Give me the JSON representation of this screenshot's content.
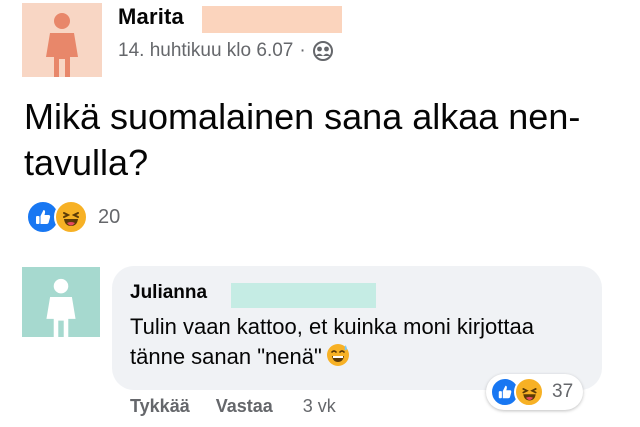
{
  "post": {
    "author": "Marita",
    "timestamp": "14. huhtikuu klo 6.07",
    "separator": "·",
    "audience_icon": "friends-icon",
    "text": "Mikä suomalainen sana alkaa nen- tavulla?",
    "reaction_types": [
      "like",
      "haha"
    ],
    "reaction_count": "20",
    "avatar_color": "#f8d6c4",
    "avatar_figure_color": "#e8876a"
  },
  "comment": {
    "author": "Julianna",
    "text": "Tulin vaan kattoo, et kuinka moni kirjottaa tänne sanan \"nenä\"",
    "emoji": "grinning-sweat-emoji",
    "reaction_types": [
      "like",
      "haha"
    ],
    "reaction_count": "37",
    "actions": {
      "like": "Tykkää",
      "reply": "Vastaa"
    },
    "time_ago": "3 vk",
    "avatar_color": "#a6d9cf",
    "avatar_figure_color": "#ffffff"
  },
  "colors": {
    "like_blue": "#1877f2",
    "haha_yellow": "#f7b125",
    "secondary_text": "#65676b",
    "bubble_bg": "#f0f2f5"
  }
}
